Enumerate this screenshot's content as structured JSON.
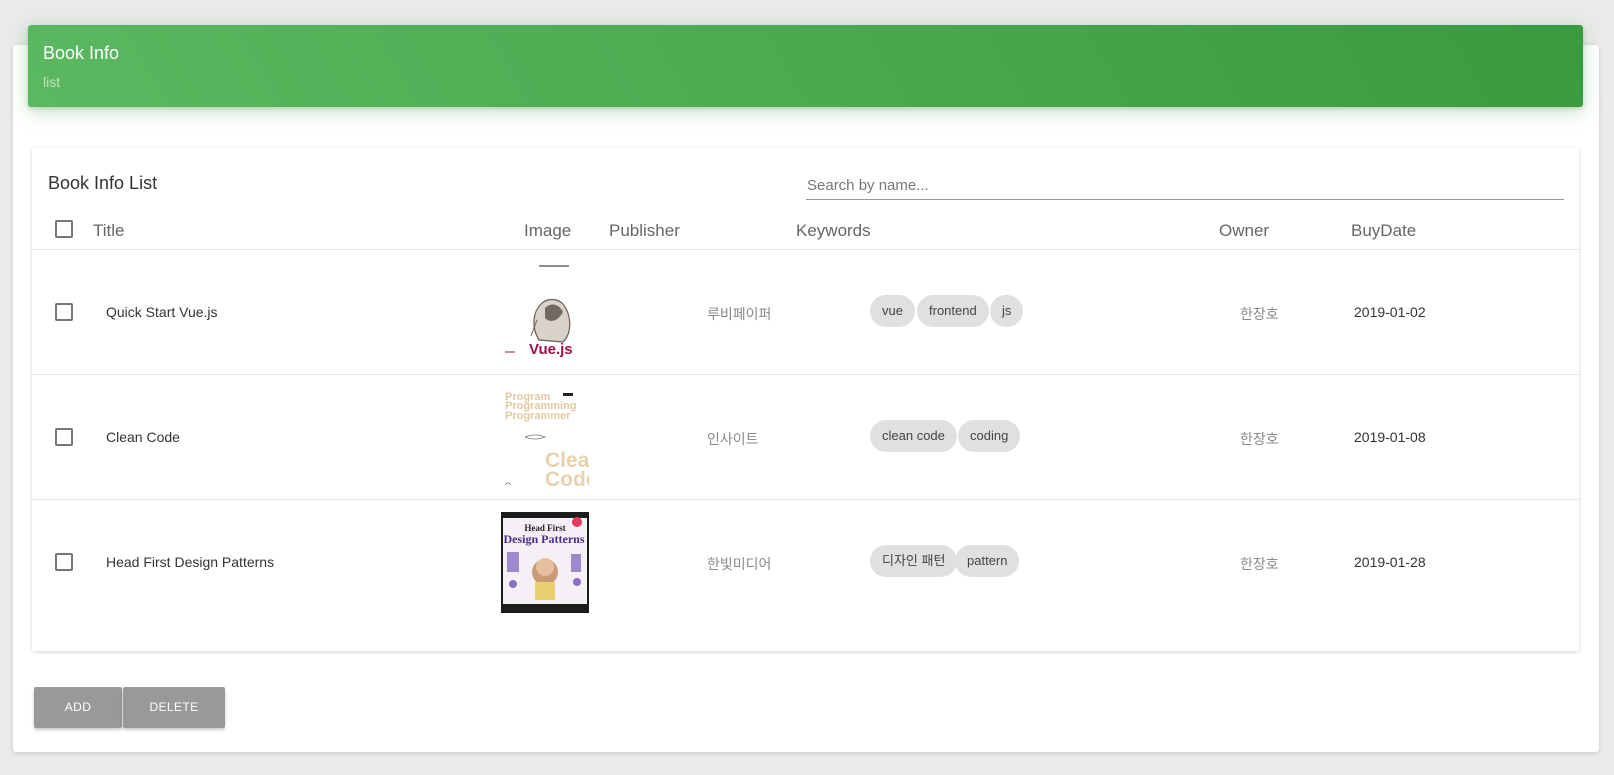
{
  "header": {
    "title": "Book Info",
    "subtitle": "list"
  },
  "panel": {
    "title": "Book Info List"
  },
  "search": {
    "placeholder": "Search by name..."
  },
  "columns": {
    "title": "Title",
    "image": "Image",
    "publisher": "Publisher",
    "keywords": "Keywords",
    "owner": "Owner",
    "buydate": "BuyDate"
  },
  "books": [
    {
      "title": "Quick Start Vue.js",
      "cover_text": "Vue.js",
      "publisher": "루비페이퍼",
      "keywords": [
        "vue",
        "frontend",
        "js"
      ],
      "owner": "한장호",
      "buydate": "2019-01-02"
    },
    {
      "title": "Clean Code",
      "cover_text_1": "Program",
      "cover_text_2": "Programming",
      "cover_text_3": "Programmer",
      "cover_text_4": "Clean",
      "cover_text_5": "Code",
      "publisher": "인사이트",
      "keywords": [
        "clean code",
        "coding"
      ],
      "owner": "한장호",
      "buydate": "2019-01-08"
    },
    {
      "title": "Head First Design Patterns",
      "cover_text_1": "Head First",
      "cover_text_2": "Design Patterns",
      "publisher": "한빛미디어",
      "keywords": [
        "디자인 패턴",
        "pattern"
      ],
      "owner": "한장호",
      "buydate": "2019-01-28"
    }
  ],
  "buttons": {
    "add": "ADD",
    "delete": "DELETE"
  },
  "colors": {
    "header_start": "#5cb860",
    "header_end": "#3a9a3f",
    "button": "#999999",
    "chip": "#e0e0e0"
  }
}
